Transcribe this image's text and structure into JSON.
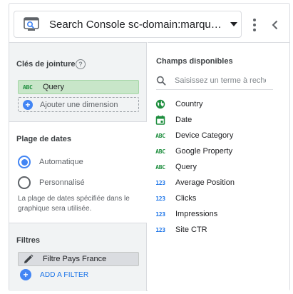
{
  "source": {
    "name": "Search Console sc-domain:marques...",
    "icon": "search-console-icon"
  },
  "join_keys": {
    "title": "Clés de jointure",
    "help_icon": "?",
    "key": {
      "type": "ABC",
      "label": "Query"
    },
    "add_dimension_label": "Ajouter une dimension"
  },
  "date_range": {
    "title": "Plage de dates",
    "options": [
      {
        "label": "Automatique",
        "selected": true
      },
      {
        "label": "Personnalisé",
        "selected": false
      }
    ],
    "note": "La plage de dates spécifiée dans le graphique sera utilisée."
  },
  "filters": {
    "title": "Filtres",
    "items": [
      {
        "label": "Filtre Pays France"
      }
    ],
    "add_label": "ADD A FILTER"
  },
  "available_fields": {
    "title": "Champs disponibles",
    "search_placeholder": "Saisissez un terme à rechercher",
    "fields": [
      {
        "type": "geo",
        "type_label": "",
        "label": "Country"
      },
      {
        "type": "date",
        "type_label": "",
        "label": "Date"
      },
      {
        "type": "text",
        "type_label": "ABC",
        "label": "Device Category"
      },
      {
        "type": "text",
        "type_label": "ABC",
        "label": "Google Property"
      },
      {
        "type": "text",
        "type_label": "ABC",
        "label": "Query"
      },
      {
        "type": "number",
        "type_label": "123",
        "label": "Average Position"
      },
      {
        "type": "number",
        "type_label": "123",
        "label": "Clicks"
      },
      {
        "type": "number",
        "type_label": "123",
        "label": "Impressions"
      },
      {
        "type": "number",
        "type_label": "123",
        "label": "Site CTR"
      }
    ]
  },
  "colors": {
    "dimension_green": "#1e8e3e",
    "metric_blue": "#1a73e8",
    "accent_blue": "#4285f4",
    "panel_gray": "#f1f3f4"
  }
}
